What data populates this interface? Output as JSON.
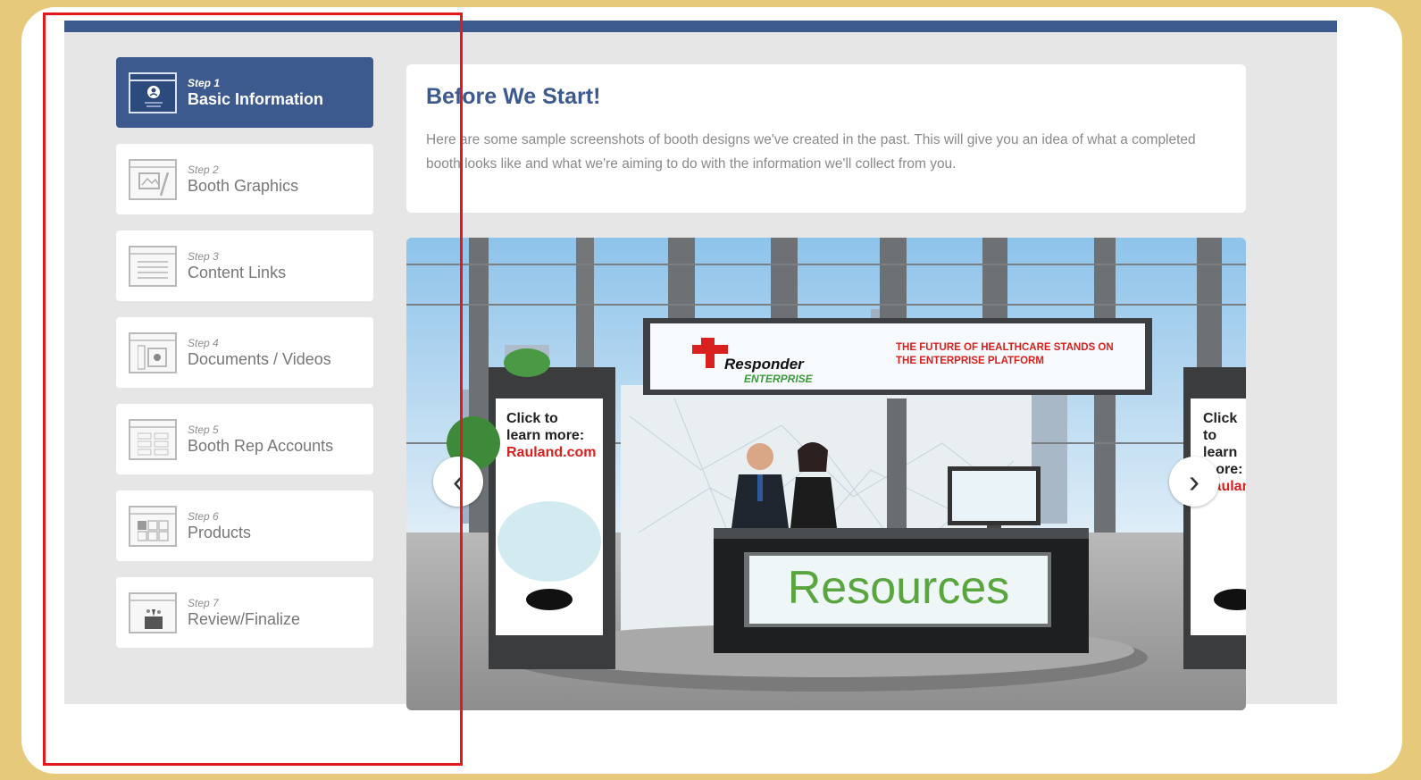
{
  "steps": [
    {
      "num": "Step 1",
      "title": "Basic Information",
      "icon": "person-icon",
      "active": true
    },
    {
      "num": "Step 2",
      "title": "Booth Graphics",
      "icon": "graphics-icon",
      "active": false
    },
    {
      "num": "Step 3",
      "title": "Content Links",
      "icon": "links-icon",
      "active": false
    },
    {
      "num": "Step 4",
      "title": "Documents / Videos",
      "icon": "documents-icon",
      "active": false
    },
    {
      "num": "Step 5",
      "title": "Booth Rep Accounts",
      "icon": "accounts-icon",
      "active": false
    },
    {
      "num": "Step 6",
      "title": "Products",
      "icon": "products-icon",
      "active": false
    },
    {
      "num": "Step 7",
      "title": "Review/Finalize",
      "icon": "review-icon",
      "active": false
    }
  ],
  "intro": {
    "title": "Before We Start!",
    "body": "Here are some sample screenshots of booth designs we've created in the past. This will give you an idea of what a completed booth looks like and what we're aiming to do with the information we'll collect from you."
  },
  "booth": {
    "banner_brand": "Responder",
    "banner_sub": "ENTERPRISE",
    "banner_tagline": "THE FUTURE OF HEALTHCARE STANDS ON THE ENTERPRISE PLATFORM",
    "left_panel_text": "Click to learn more:",
    "left_panel_link": "Rauland.com",
    "right_panel_text": "Click to learn more:",
    "right_panel_link": "Raulan",
    "desk_label": "Resources",
    "prev_glyph": "‹",
    "next_glyph": "›"
  },
  "colors": {
    "accent": "#3d5a8e",
    "background": "#e7c97c",
    "highlight": "#e4171b",
    "resources_green": "#5aa63e",
    "brand_red": "#d8201f"
  }
}
